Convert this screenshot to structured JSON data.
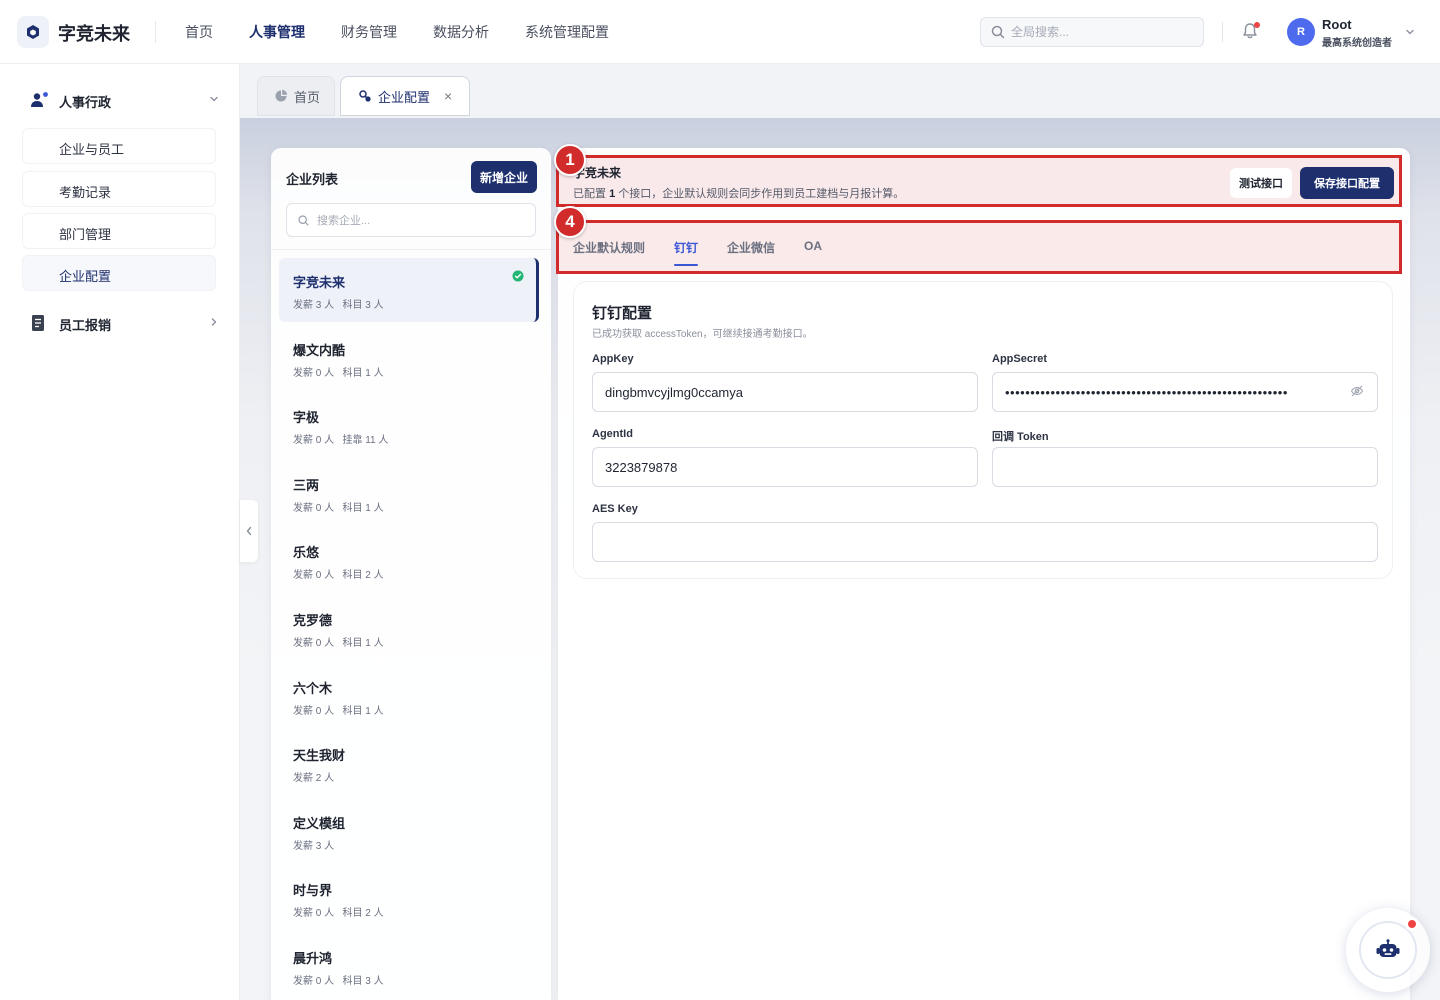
{
  "app": {
    "name": "字竞未来",
    "nav": [
      "首页",
      "人事管理",
      "财务管理",
      "数据分析",
      "系统管理配置"
    ],
    "active_nav": "人事管理",
    "search_placeholder": "全局搜索...",
    "user": {
      "avatar_letter": "R",
      "name": "Root",
      "role": "最高系统创造者"
    }
  },
  "sidebar": {
    "groups": [
      {
        "label": "人事行政",
        "expanded": true,
        "items": [
          "企业与员工",
          "考勤记录",
          "部门管理",
          "企业配置"
        ],
        "active_item": "企业配置"
      },
      {
        "label": "员工报销",
        "expanded": false
      }
    ]
  },
  "tabs": [
    {
      "label": "首页",
      "closable": false
    },
    {
      "label": "企业配置",
      "closable": true,
      "active": true,
      "close_glyph": "×"
    }
  ],
  "company_list": {
    "title": "企业列表",
    "add_button": "新增企业",
    "search_placeholder": "搜索企业...",
    "items": [
      {
        "name": "字竞未来",
        "meta": "发薪 3 人   科目 3 人",
        "active": true,
        "configured": true
      },
      {
        "name": "爆文内酷",
        "meta": "发薪 0 人   科目 1 人"
      },
      {
        "name": "字极",
        "meta": "发薪 0 人   挂靠 11 人"
      },
      {
        "name": "三两",
        "meta": "发薪 0 人   科目 1 人"
      },
      {
        "name": "乐悠",
        "meta": "发薪 0 人   科目 2 人"
      },
      {
        "name": "克罗德",
        "meta": "发薪 0 人   科目 1 人"
      },
      {
        "name": "六个木",
        "meta": "发薪 0 人   科目 1 人"
      },
      {
        "name": "天生我财",
        "meta": "发薪 2 人"
      },
      {
        "name": "定义模组",
        "meta": "发薪 3 人"
      },
      {
        "name": "时与界",
        "meta": "发薪 0 人   科目 2 人"
      },
      {
        "name": "晨升鸿",
        "meta": "发薪 0 人   科目 3 人"
      }
    ]
  },
  "config": {
    "company_name": "字竞未来",
    "desc_prefix": "已配置 ",
    "desc_count": "1",
    "desc_suffix": " 个接口，企业默认规则会同步作用到员工建档与月报计算。",
    "test_button": "测试接口",
    "save_button": "保存接口配置",
    "tabs": [
      "企业默认规则",
      "钉钉",
      "企业微信",
      "OA"
    ],
    "active_tab": "钉钉",
    "annotations": [
      "1",
      "4"
    ],
    "form": {
      "title": "钉钉配置",
      "subtitle": "已成功获取 accessToken，可继续接通考勤接口。",
      "fields": [
        {
          "label": "AppKey",
          "value": "dingbmvcyjlmg0ccamya",
          "type": "text"
        },
        {
          "label": "AppSecret",
          "value": "••••••••••••••••••••••••••••••••••••••••••••••••••••••••",
          "type": "password"
        },
        {
          "label": "AgentId",
          "value": "3223879878",
          "type": "text"
        },
        {
          "label": "回调 Token",
          "value": "",
          "type": "text"
        },
        {
          "label": "AES Key",
          "value": "",
          "type": "text"
        }
      ]
    }
  },
  "colors": {
    "brand": "#1e2f6e",
    "accent": "#3b57d6",
    "annotation": "#d12b2b",
    "success": "#22b573",
    "alert": "#ef4444"
  }
}
